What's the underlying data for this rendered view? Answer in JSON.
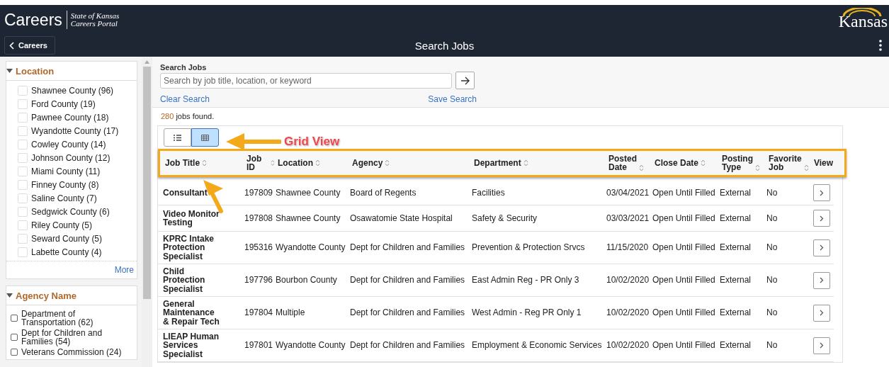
{
  "header": {
    "brand": "Careers",
    "tagline_1": "State of Kansas",
    "tagline_2": "Careers Portal",
    "logo_text": "Kansas",
    "back_button": "Careers",
    "page_title": "Search Jobs"
  },
  "sidebar": {
    "panels": [
      {
        "title": "Location",
        "expanded": true,
        "kind": "compact",
        "more": "More",
        "items": [
          {
            "label": "Shawnee County (96)",
            "checked": false
          },
          {
            "label": "Ford County (19)",
            "checked": false
          },
          {
            "label": "Pawnee County (18)",
            "checked": false
          },
          {
            "label": "Wyandotte County (17)",
            "checked": false
          },
          {
            "label": "Cowley County (14)",
            "checked": false
          },
          {
            "label": "Johnson County (12)",
            "checked": false
          },
          {
            "label": "Miami County (11)",
            "checked": false
          },
          {
            "label": "Finney County (8)",
            "checked": false
          },
          {
            "label": "Saline County (7)",
            "checked": false
          },
          {
            "label": "Sedgwick County (6)",
            "checked": false
          },
          {
            "label": "Riley County (5)",
            "checked": false
          },
          {
            "label": "Seward County (5)",
            "checked": false
          },
          {
            "label": "Labette County (4)",
            "checked": false
          }
        ]
      },
      {
        "title": "Agency Name",
        "expanded": true,
        "kind": "wrapped",
        "items": [
          {
            "label": "Department of Transportation (62)",
            "checked": false
          },
          {
            "label": "Dept for Children and Families (54)",
            "checked": false
          },
          {
            "label": "Veterans Commission (24)",
            "checked": false
          }
        ]
      }
    ]
  },
  "search": {
    "label": "Search Jobs",
    "placeholder": "Search by job title, location, or keyword",
    "clear": "Clear Search",
    "save": "Save Search"
  },
  "results": {
    "count": "280",
    "text": "jobs found."
  },
  "view_buttons": [
    {
      "kind": "list",
      "selected": false
    },
    {
      "kind": "grid",
      "selected": true
    }
  ],
  "annotation": {
    "label": "Grid View"
  },
  "table": {
    "columns": [
      {
        "label": "Job Title",
        "sortable": true
      },
      {
        "label": "Job ID",
        "sortable": true
      },
      {
        "label": "Location",
        "sortable": true
      },
      {
        "label": "Agency",
        "sortable": true
      },
      {
        "label": "Department",
        "sortable": true
      },
      {
        "label": "Posted Date",
        "sortable": true
      },
      {
        "label": "Close Date",
        "sortable": true
      },
      {
        "label": "Posting Type",
        "sortable": true
      },
      {
        "label": "Favorite Job",
        "sortable": true
      },
      {
        "label": "View",
        "sortable": false
      }
    ],
    "rows": [
      [
        "Consultant",
        "197809",
        "Shawnee County",
        "Board of Regents",
        "Facilities",
        "03/04/2021",
        "Open Until Filled",
        "External",
        "No"
      ],
      [
        "Video Monitor Testing",
        "197808",
        "Shawnee County",
        "Osawatomie State Hospital",
        "Safety & Security",
        "03/03/2021",
        "Open Until Filled",
        "External",
        "No"
      ],
      [
        "KPRC Intake Protection Specialist",
        "195316",
        "Wyandotte County",
        "Dept for Children and Families",
        "Prevention & Protection Srvcs",
        "11/15/2020",
        "Open Until Filled",
        "External",
        "No"
      ],
      [
        "Child Protection Specialist",
        "197796",
        "Bourbon County",
        "Dept for Children and Families",
        "East Admin Reg - PR Only 3",
        "10/02/2020",
        "Open Until Filled",
        "External",
        "No"
      ],
      [
        "General Maintenance & Repair Tech",
        "197804",
        "Multiple",
        "Dept for Children and Families",
        "West Admin - Reg PR Only 1",
        "10/02/2020",
        "Open Until Filled",
        "External",
        "No"
      ],
      [
        "LIEAP Human Services Specialist",
        "197801",
        "Wyandotte County",
        "Dept for Children and Families",
        "Employment & Economic Services",
        "10/02/2020",
        "Open Until Filled",
        "External",
        "No"
      ]
    ]
  }
}
